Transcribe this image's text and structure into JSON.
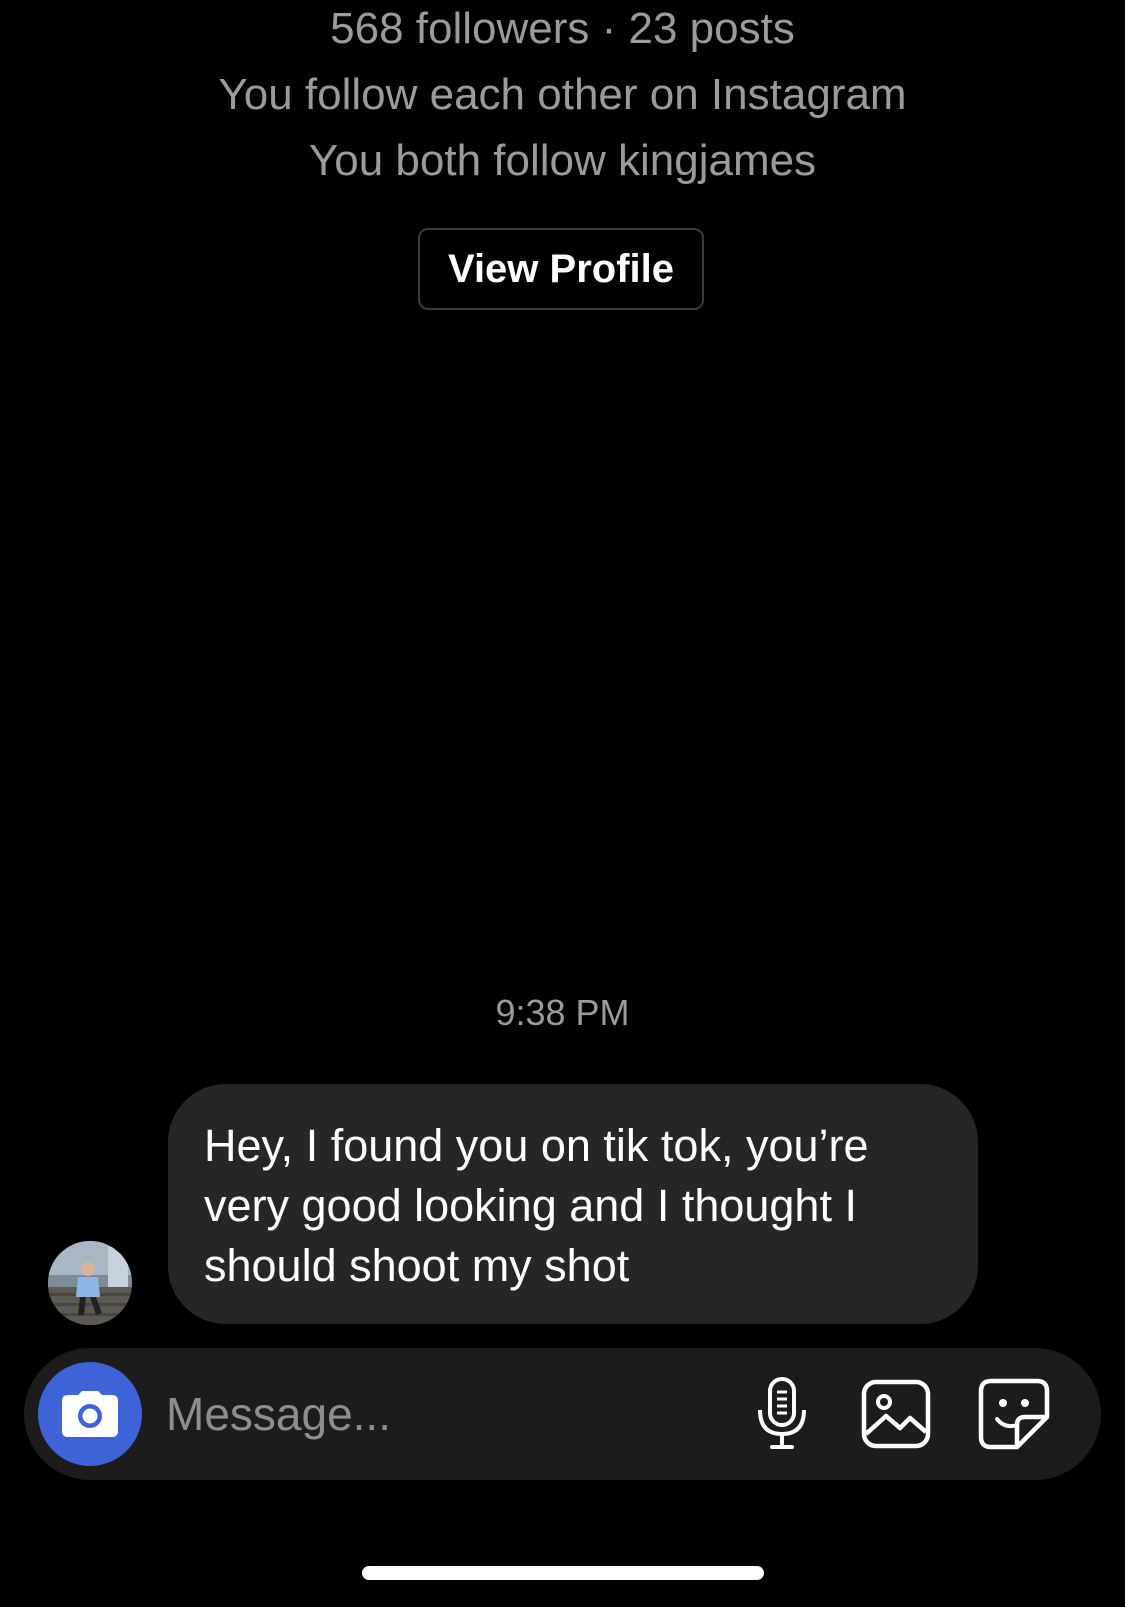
{
  "profile": {
    "stats": "568 followers · 23 posts",
    "mutual_line": "You follow each other on Instagram",
    "common_follow": "You both follow kingjames",
    "view_profile_label": "View Profile"
  },
  "thread": {
    "timestamp": "9:38 PM",
    "messages": [
      {
        "sender": "other",
        "text": "Hey, I found you on tik tok, you’re very good looking and I thought I should shoot my shot"
      }
    ]
  },
  "composer": {
    "placeholder": "Message...",
    "icons": [
      "camera-icon",
      "microphone-icon",
      "gallery-icon",
      "sticker-icon"
    ],
    "accent_color": "#3d63d6"
  },
  "colors": {
    "background": "#000000",
    "secondary_text": "#9b9b9b",
    "bubble": "#262626",
    "composer": "#1c1c1c"
  }
}
